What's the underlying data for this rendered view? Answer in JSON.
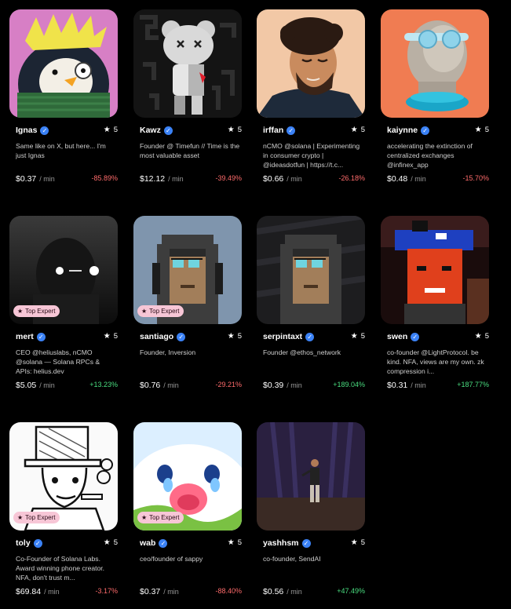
{
  "labels": {
    "per_min": "/ min",
    "top_expert": "Top Expert"
  },
  "colors": {
    "positive": "#4ade80",
    "negative": "#ff6b6b",
    "badge_bg": "#f7c6d6",
    "verified": "#3b82f6"
  },
  "creators": [
    {
      "name": "Ignas",
      "rating": "5",
      "bio": "Same like on X, but here... I'm just Ignas",
      "price": "$0.37",
      "change": "-85.89%",
      "trend": "down",
      "top_expert": false,
      "avatar": "penguin-avatar"
    },
    {
      "name": "Kawz",
      "rating": "5",
      "bio": "Founder @ Timefun // Time is the most valuable asset",
      "price": "$12.12",
      "change": "-39.49%",
      "trend": "down",
      "top_expert": false,
      "avatar": "kaws-figure-avatar"
    },
    {
      "name": "irffan",
      "rating": "5",
      "bio": "nCMO @solana | Experimenting in consumer crypto | @ideasdotfun | https://t.c...",
      "price": "$0.66",
      "change": "-26.18%",
      "trend": "down",
      "top_expert": false,
      "avatar": "illustrated-man-avatar"
    },
    {
      "name": "kaiynne",
      "rating": "5",
      "bio": "accelerating the extinction of centralized exchanges @infinex_app",
      "price": "$0.48",
      "change": "-15.70%",
      "trend": "down",
      "top_expert": false,
      "avatar": "meme-man-avatar"
    },
    {
      "name": "mert",
      "rating": "5",
      "bio": "CEO @heliuslabs, nCMO @solana — Solana RPCs & APIs: helius.dev",
      "price": "$5.05",
      "change": "+13.23%",
      "trend": "up",
      "top_expert": true,
      "avatar": "dark-figure-avatar"
    },
    {
      "name": "santiago",
      "rating": "5",
      "bio": "Founder, Inversion",
      "price": "$0.76",
      "change": "-29.21%",
      "trend": "down",
      "top_expert": true,
      "avatar": "pixel-hoodie-avatar"
    },
    {
      "name": "serpintaxt",
      "rating": "5",
      "bio": "Founder @ethos_network",
      "price": "$0.39",
      "change": "+189.04%",
      "trend": "up",
      "top_expert": false,
      "avatar": "pixel-hoodie-dark-avatar"
    },
    {
      "name": "swen",
      "rating": "5",
      "bio": "co-founder @LightProtocol. be kind. NFA, views are my own. zk compression i...",
      "price": "$0.31",
      "change": "+187.77%",
      "trend": "up",
      "top_expert": false,
      "avatar": "pixel-orca-hat-avatar"
    },
    {
      "name": "toly",
      "rating": "5",
      "bio": "Co-Founder of Solana Labs. Award winning phone creator. NFA, don't trust m...",
      "price": "$69.84",
      "change": "-3.17%",
      "trend": "down",
      "top_expert": true,
      "avatar": "sketch-hat-avatar"
    },
    {
      "name": "wab",
      "rating": "5",
      "bio": "ceo/founder of sappy",
      "price": "$0.37",
      "change": "-88.40%",
      "trend": "down",
      "top_expert": true,
      "avatar": "crying-seal-avatar"
    },
    {
      "name": "yashhsm",
      "rating": "5",
      "bio": "co-founder, SendAI",
      "price": "$0.56",
      "change": "+47.49%",
      "trend": "up",
      "top_expert": false,
      "avatar": "stage-speaker-avatar"
    }
  ]
}
